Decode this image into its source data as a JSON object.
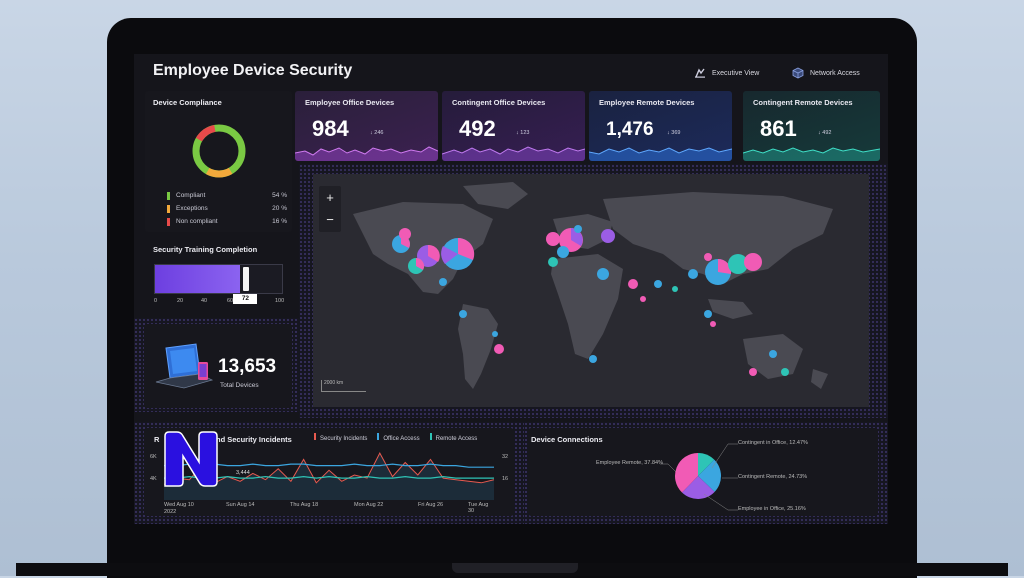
{
  "dashboard": {
    "title": "Employee Device Security",
    "executive_view": "Executive View",
    "network_access": "Network Access"
  },
  "kpis": [
    {
      "label": "Employee Office Devices",
      "value": "984",
      "delta": "↓ 246"
    },
    {
      "label": "Contingent Office Devices",
      "value": "492",
      "delta": "↓ 123"
    },
    {
      "label": "Employee Remote Devices",
      "value": "1,476",
      "delta": "↓ 369"
    },
    {
      "label": "Contingent Remote Devices",
      "value": "861",
      "delta": "↓ 492"
    }
  ],
  "compliance": {
    "title": "Device Compliance",
    "items": [
      {
        "label": "Compliant",
        "value": "54 %",
        "color": "#7ac943"
      },
      {
        "label": "Exceptions",
        "value": "20 %",
        "color": "#f2a93b"
      },
      {
        "label": "Non compliant",
        "value": "16 %",
        "color": "#e84a4a"
      }
    ]
  },
  "training": {
    "title": "Security Training Completion",
    "value": 72,
    "value_label": "72",
    "ticks": [
      "0",
      "20",
      "40",
      "60",
      "100"
    ]
  },
  "total_devices": {
    "value": "13,653",
    "label": "Total Devices"
  },
  "map": {
    "zoom_in": "+",
    "zoom_out": "−",
    "scale": "2000 km"
  },
  "incidents": {
    "title_start": "R",
    "title_end": "nd Security Incidents",
    "legend": [
      {
        "label": "Security Incidents",
        "color": "#e85a4f"
      },
      {
        "label": "Office Access",
        "color": "#3ba6e0"
      },
      {
        "label": "Remote Access",
        "color": "#2ec4b6"
      }
    ],
    "annotation": "3,444",
    "y_left": [
      "6K",
      "4K"
    ],
    "y_right": [
      "32",
      "16"
    ],
    "x_labels": [
      "Wed Aug 10",
      "Sun Aug 14",
      "Thu Aug 18",
      "Mon Aug 22",
      "Fri Aug 26",
      "Tue Aug 30"
    ],
    "year": "2022",
    "logo_letter": "N",
    "chart_data": {
      "type": "line",
      "series": [
        {
          "name": "Security Incidents",
          "values": [
            10,
            14,
            13,
            22,
            11,
            15,
            12,
            17,
            13,
            20,
            12,
            26,
            11,
            19,
            12,
            16,
            14,
            30,
            15,
            24,
            16,
            26,
            14,
            13,
            12,
            11,
            13
          ]
        },
        {
          "name": "Office Access",
          "values": [
            22,
            22,
            23,
            22,
            23,
            22,
            22,
            23,
            22,
            22,
            23,
            23,
            22,
            22,
            22,
            23,
            22,
            22,
            23,
            22,
            22,
            23,
            22,
            22,
            21,
            21,
            21
          ]
        },
        {
          "name": "Remote Access",
          "values": [
            14,
            14,
            15,
            14,
            14,
            15,
            14,
            14,
            15,
            14,
            14,
            15,
            14,
            15,
            14,
            14,
            15,
            14,
            14,
            15,
            14,
            14,
            15,
            14,
            14,
            14,
            14
          ]
        }
      ]
    }
  },
  "connections": {
    "title": "Device Connections",
    "labels": [
      {
        "text": "Contingent in Office, 12.47%"
      },
      {
        "text": "Employee Remote, 37.84%"
      },
      {
        "text": "Contingent Remote, 24.73%"
      },
      {
        "text": "Employee in Office, 25.16%"
      }
    ],
    "slices": [
      {
        "name": "Contingent in Office",
        "value": 12.47,
        "color": "#2ec4b6"
      },
      {
        "name": "Contingent Remote",
        "value": 24.73,
        "color": "#3ba6e0"
      },
      {
        "name": "Employee in Office",
        "value": 25.16,
        "color": "#9b5de5"
      },
      {
        "name": "Employee Remote",
        "value": 37.84,
        "color": "#f15bb5"
      }
    ]
  }
}
